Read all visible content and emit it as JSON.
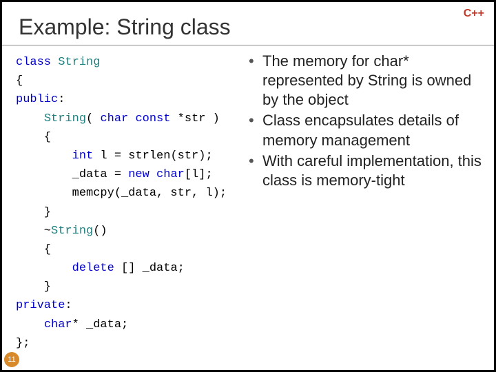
{
  "badge": "C++",
  "title": "Example: String class",
  "slide_number": "11",
  "code": {
    "l0_kw": "class",
    "l0_cls": "String",
    "l1": "{",
    "l2_kw": "public",
    "l3_cls": "String",
    "l3_sig_a": "( ",
    "l3_kw1": "char",
    "l3_sp": " ",
    "l3_kw2": "const",
    "l3_sig_b": " *str )",
    "l4": "    {",
    "l5_pre": "        ",
    "l5_kw": "int",
    "l5_rest": " l = strlen(str);",
    "l6": "        _data = ",
    "l6_kw": "new",
    "l6_sp": " ",
    "l6_typ": "char",
    "l6_rest": "[l];",
    "l7": "        memcpy(_data, str, l);",
    "l8": "    }",
    "l9_pre": "    ~",
    "l9_cls": "String",
    "l9_rest": "()",
    "l10": "    {",
    "l11_pre": "        ",
    "l11_kw": "delete",
    "l11_rest": " [] _data;",
    "l12": "    }",
    "l13_kw": "private",
    "l14_pre": "    ",
    "l14_typ": "char",
    "l14_rest": "* _data;",
    "l15": "};"
  },
  "bullets": [
    "The memory for char* represented by String is owned by the object",
    "Class encapsulates details of memory management",
    "With careful implementation, this class is memory-tight"
  ]
}
